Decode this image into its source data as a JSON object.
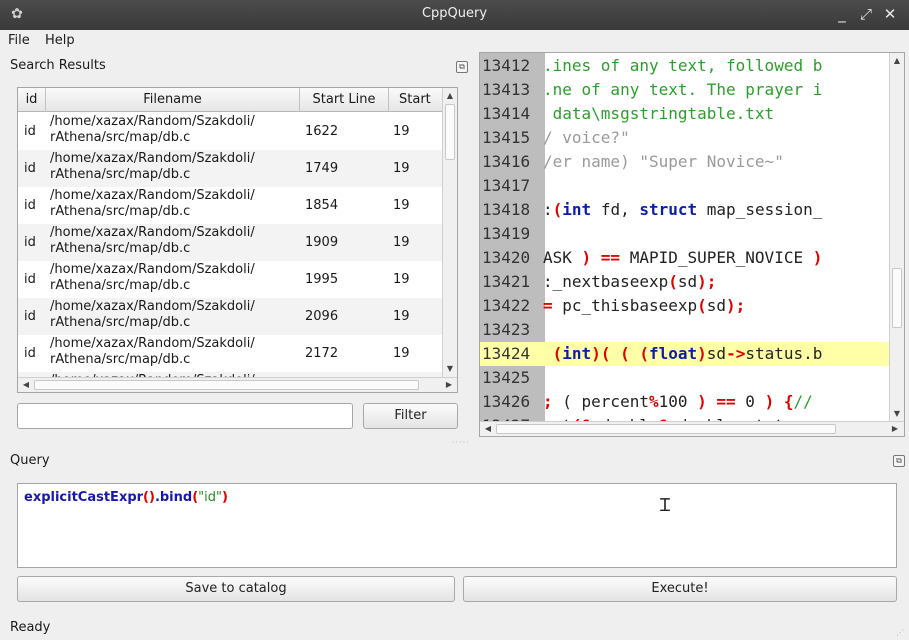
{
  "window": {
    "title": "CppQuery",
    "minimize_glyph": "_",
    "maximize_glyph": "⤢",
    "close_glyph": "✕",
    "app_icon_glyph": "✿"
  },
  "menu": {
    "file": "File",
    "help": "Help"
  },
  "search": {
    "title": "Search Results",
    "columns": [
      "id",
      "Filename",
      "Start Line",
      "Start"
    ],
    "rows": [
      {
        "id": "id",
        "filename": "/home/xazax/Random/Szakdoli/\nrAthena/src/map/db.c",
        "start_line": "1622",
        "start": "19"
      },
      {
        "id": "id",
        "filename": "/home/xazax/Random/Szakdoli/\nrAthena/src/map/db.c",
        "start_line": "1749",
        "start": "19"
      },
      {
        "id": "id",
        "filename": "/home/xazax/Random/Szakdoli/\nrAthena/src/map/db.c",
        "start_line": "1854",
        "start": "19"
      },
      {
        "id": "id",
        "filename": "/home/xazax/Random/Szakdoli/\nrAthena/src/map/db.c",
        "start_line": "1909",
        "start": "19"
      },
      {
        "id": "id",
        "filename": "/home/xazax/Random/Szakdoli/\nrAthena/src/map/db.c",
        "start_line": "1995",
        "start": "19"
      },
      {
        "id": "id",
        "filename": "/home/xazax/Random/Szakdoli/\nrAthena/src/map/db.c",
        "start_line": "2096",
        "start": "19"
      },
      {
        "id": "id",
        "filename": "/home/xazax/Random/Szakdoli/\nrAthena/src/map/db.c",
        "start_line": "2172",
        "start": "19"
      },
      {
        "id": "",
        "filename": "/home/xazax/Random/Szakdoli/",
        "start_line": "",
        "start": ""
      }
    ],
    "filter_value": "",
    "filter_button": "Filter"
  },
  "code": {
    "lines": [
      {
        "num": "13412",
        "parts": [
          {
            "t": ".ines of any text, followed b",
            "c": "comment"
          }
        ]
      },
      {
        "num": "13413",
        "parts": [
          {
            "t": ".ne of any text. The prayer i",
            "c": "comment"
          }
        ]
      },
      {
        "num": "13414",
        "parts": [
          {
            "t": " data\\msgstringtable.txt",
            "c": "comment"
          }
        ]
      },
      {
        "num": "13415",
        "parts": [
          {
            "t": "/ voice?\"",
            "c": "str"
          }
        ]
      },
      {
        "num": "13416",
        "parts": [
          {
            "t": "/er name) \"Super Novice~\"",
            "c": "str"
          }
        ]
      },
      {
        "num": "13417",
        "parts": []
      },
      {
        "num": "13418",
        "parts": [
          {
            "t": ":",
            "c": "plain"
          },
          {
            "t": "(",
            "c": "op"
          },
          {
            "t": "int",
            "c": "kw"
          },
          {
            "t": " fd, ",
            "c": "plain"
          },
          {
            "t": "struct",
            "c": "kw"
          },
          {
            "t": " map_session_",
            "c": "plain"
          }
        ]
      },
      {
        "num": "13419",
        "parts": []
      },
      {
        "num": "13420",
        "parts": [
          {
            "t": "ASK ",
            "c": "plain"
          },
          {
            "t": ") ==",
            "c": "op"
          },
          {
            "t": " MAPID_SUPER_NOVICE ",
            "c": "plain"
          },
          {
            "t": ")",
            "c": "op"
          }
        ]
      },
      {
        "num": "13421",
        "parts": [
          {
            "t": ":_nextbaseexp",
            "c": "plain"
          },
          {
            "t": "(",
            "c": "op"
          },
          {
            "t": "sd",
            "c": "plain"
          },
          {
            "t": ");",
            "c": "op"
          }
        ]
      },
      {
        "num": "13422",
        "parts": [
          {
            "t": "= ",
            "c": "op"
          },
          {
            "t": "pc_thisbaseexp",
            "c": "plain"
          },
          {
            "t": "(",
            "c": "op"
          },
          {
            "t": "sd",
            "c": "plain"
          },
          {
            "t": ");",
            "c": "op"
          }
        ]
      },
      {
        "num": "13423",
        "parts": []
      },
      {
        "num": "13424",
        "hl": true,
        "parts": [
          {
            "t": " ",
            "c": "plain"
          },
          {
            "t": "(",
            "c": "op"
          },
          {
            "t": "int",
            "c": "kw"
          },
          {
            "t": ")( ( (",
            "c": "op"
          },
          {
            "t": "float",
            "c": "kw"
          },
          {
            "t": ")",
            "c": "op"
          },
          {
            "t": "sd",
            "c": "plain"
          },
          {
            "t": "->",
            "c": "op"
          },
          {
            "t": "status.b",
            "c": "plain"
          }
        ]
      },
      {
        "num": "13425",
        "parts": []
      },
      {
        "num": "13426",
        "parts": [
          {
            "t": "; ",
            "c": "op"
          },
          {
            "t": "( percent",
            "c": "plain"
          },
          {
            "t": "%",
            "c": "op"
          },
          {
            "t": "100 ",
            "c": "plain"
          },
          {
            "t": ") ==",
            "c": "op"
          },
          {
            "t": " 0 ",
            "c": "plain"
          },
          {
            "t": ") {",
            "c": "op"
          },
          {
            "t": "//",
            "c": "comment"
          }
        ]
      },
      {
        "num": "13427",
        "parts": [
          {
            "t": "art",
            "c": "plain"
          },
          {
            "t": "(&",
            "c": "op"
          },
          {
            "t": "sd",
            "c": "plain"
          },
          {
            "t": "->",
            "c": "op"
          },
          {
            "t": "bl,",
            "c": "plain"
          },
          {
            "t": "&",
            "c": "op"
          },
          {
            "t": "sd",
            "c": "plain"
          },
          {
            "t": "->",
            "c": "op"
          },
          {
            "t": "bl, status_s",
            "c": "plain"
          }
        ]
      }
    ]
  },
  "query": {
    "title": "Query",
    "fn1": "explicitCastExpr",
    "paren1": "()",
    "dot_bind": ".bind",
    "paren_open": "(",
    "str": "\"id\"",
    "paren_close": ")"
  },
  "buttons": {
    "save": "Save to catalog",
    "execute": "Execute!"
  },
  "status": "Ready"
}
